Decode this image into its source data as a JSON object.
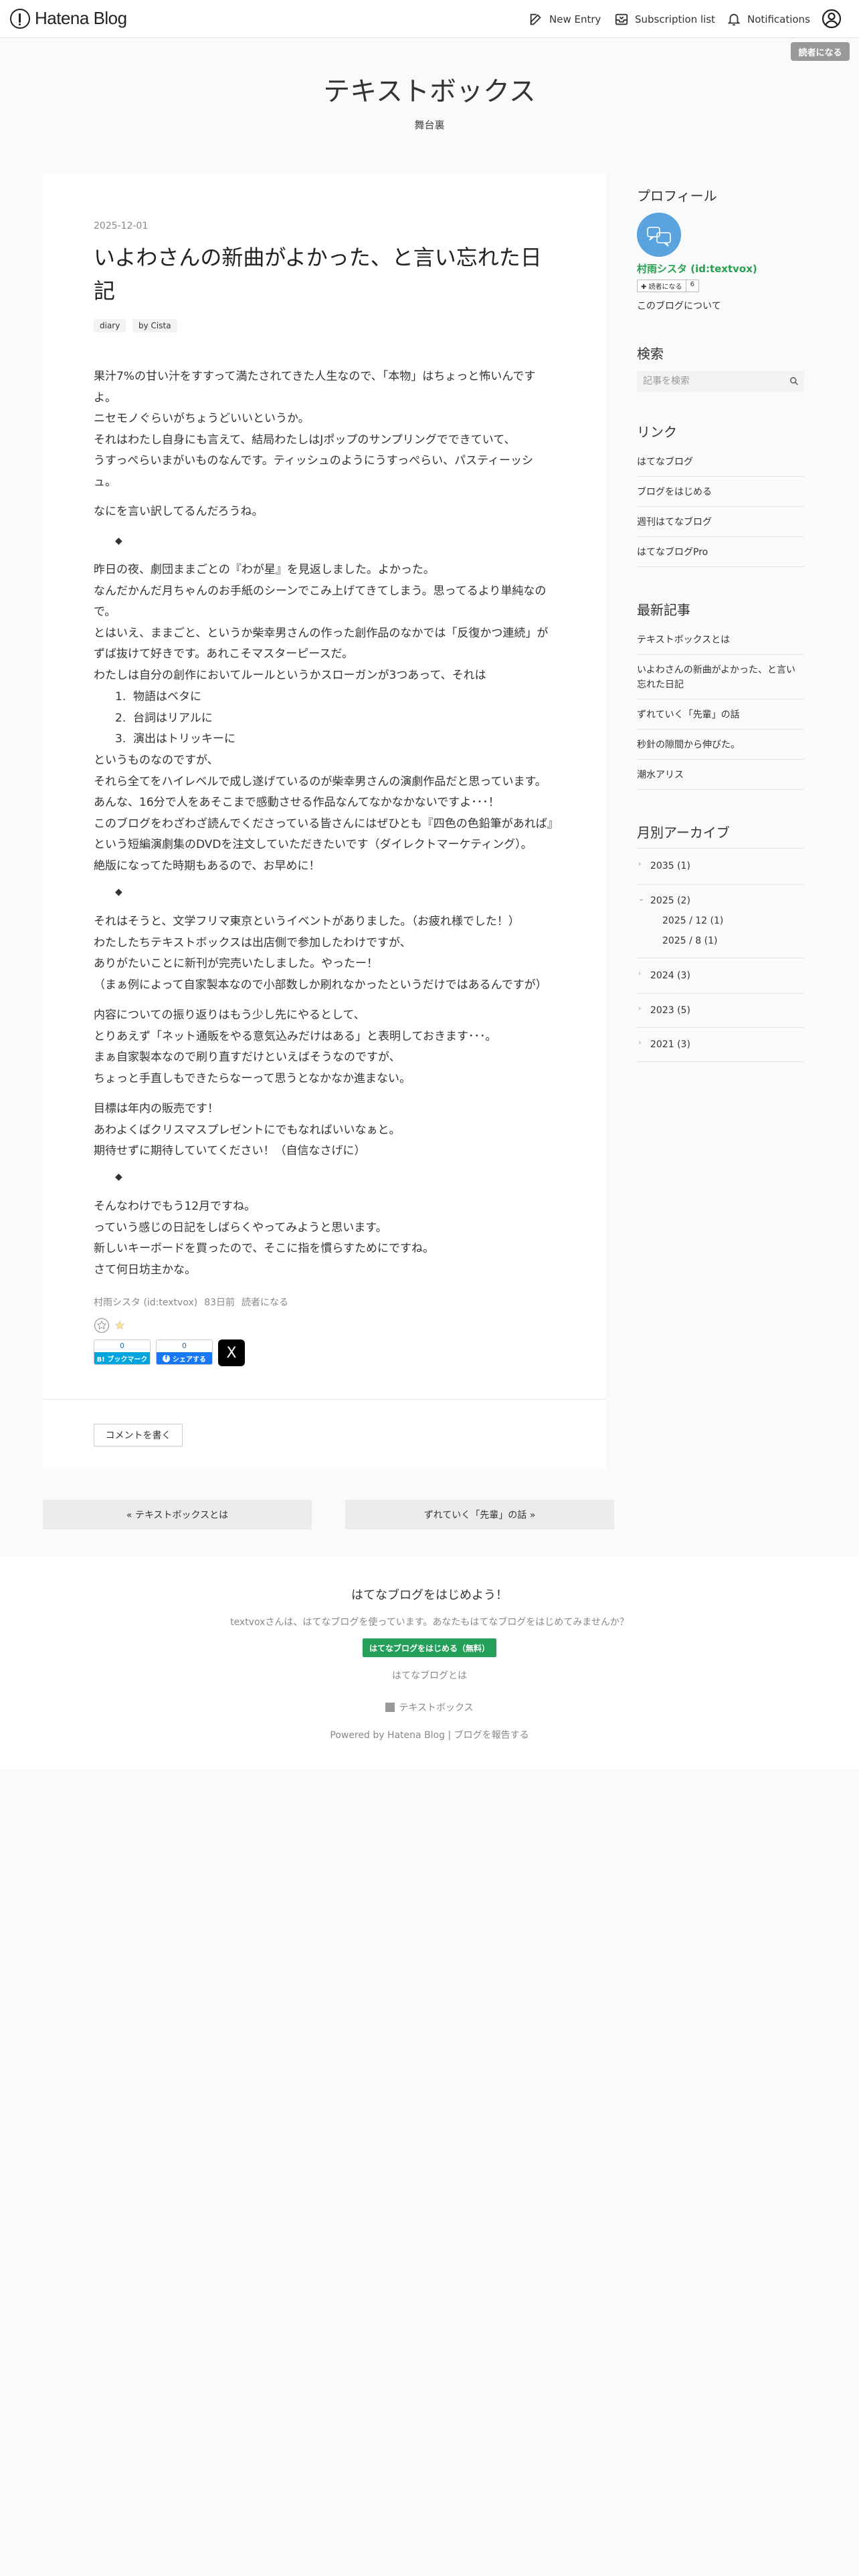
{
  "globalheader": {
    "brand": "Hatena Blog",
    "new_entry": "New Entry",
    "subscription_list": "Subscription list",
    "notifications": "Notifications"
  },
  "reader_badge": "読者になる",
  "blog": {
    "title": "テキストボックス",
    "description": "舞台裏"
  },
  "entry": {
    "date": "2025-12-01",
    "title_lines": [
      "いよわさんの新曲がよかった、と言い忘れた日",
      "記"
    ],
    "tags": [
      "diary",
      "by Cista"
    ],
    "body": {
      "p1": [
        "果汁7%の甘い汁をすすって満たされてきた人生なので、「本物」はちょっと怖いんです",
        "よ。",
        "ニセモノぐらいがちょうどいいというか。",
        "それはわたし自身にも言えて、結局わたしはJポップのサンプリングでできていて、",
        "うすっぺらいまがいものなんです。ティッシュのようにうすっぺらい、パスティーッシ",
        "ュ。"
      ],
      "p2": [
        "なにを言い訳してるんだろうね。"
      ],
      "diamond": "◆",
      "p3": [
        "昨日の夜、劇団ままごとの『わが星』を見返しました。よかった。",
        "なんだかんだ月ちゃんのお手紙のシーンでこみ上げてきてしまう。思ってるより単純なの",
        "で。",
        "とはいえ、ままごと、というか柴幸男さんの作った創作品のなかでは「反復かつ連続」が",
        "ずば抜けて好きです。あれこそマスターピースだ。",
        "わたしは自分の創作においてルールというかスローガンが3つあって、それは"
      ],
      "list": [
        "物語はベタに",
        "台詞はリアルに",
        "演出はトリッキーに"
      ],
      "p4": [
        "というものなのですが、",
        "それら全てをハイレベルで成し遂げているのが柴幸男さんの演劇作品だと思っています。",
        "あんな、16分で人をあそこまで感動させる作品なんてなかなかないですよ･･･！",
        "このブログをわざわざ読んでくださっている皆さんにはぜひとも『四色の色鉛筆があれば』",
        "という短編演劇集のDVDを注文していただきたいです（ダイレクトマーケティング）。",
        "絶版になってた時期もあるので、お早めに！"
      ],
      "p5": [
        "それはそうと、文学フリマ東京というイベントがありました。（お疲れ様でした！）",
        "わたしたちテキストボックスは出店側で参加したわけですが、",
        "ありがたいことに新刊が完売いたしました。やったー！",
        "（まぁ例によって自家製本なので小部数しか刷れなかったというだけではあるんですが）"
      ],
      "p6": [
        "内容についての振り返りはもう少し先にやるとして、",
        "とりあえず「ネット通販をやる意気込みだけはある」と表明しておきます･･･。",
        "まぁ自家製本なので刷り直すだけといえばそうなのですが、",
        "ちょっと手直しもできたらなーって思うとなかなか進まない。"
      ],
      "p7": [
        "目標は年内の販売です！",
        "あわよくばクリスマスプレゼントにでもなればいいなぁと。",
        "期待せずに期待していてください！（自信なさげに）"
      ],
      "p8": [
        "そんなわけでもう12月ですね。",
        "っていう感じの日記をしばらくやってみようと思います。",
        "新しいキーボードを買ったので、そこに指を慣らすためにですね。",
        "さて何日坊主かな。"
      ]
    },
    "footer": {
      "author": "村雨シスタ (id:textvox)",
      "ago": "83日前",
      "subscribe": "読者になる"
    },
    "share": {
      "hatebu_count": "0",
      "hatebu_label": "B! ブックマーク",
      "fb_count": "0",
      "fb_label": "シェアする",
      "x_label": "X"
    },
    "comment_button": "コメントを書く"
  },
  "pager": {
    "prev": "« テキストボックスとは",
    "next": "ずれていく「先輩」の話 »"
  },
  "sidebar": {
    "profile": {
      "heading": "プロフィール",
      "name": "村雨シスタ (id:textvox)",
      "follow_label": "読者になる",
      "follow_count": "6",
      "about": "このブログについて"
    },
    "search": {
      "heading": "検索",
      "placeholder": "記事を検索"
    },
    "links": {
      "heading": "リンク",
      "items": [
        "はてなブログ",
        "ブログをはじめる",
        "週刊はてなブログ",
        "はてなブログPro"
      ]
    },
    "recent": {
      "heading": "最新記事",
      "items": [
        "テキストボックスとは",
        "いよわさんの新曲がよかった、と言い忘れた日記",
        "ずれていく「先輩」の話",
        "秒針の隙間から伸びた。",
        "潮水アリス"
      ]
    },
    "archive": {
      "heading": "月別アーカイブ",
      "years": [
        {
          "label": "2035 (1)",
          "open": false
        },
        {
          "label": "2025 (2)",
          "open": true,
          "months": [
            "2025 / 12 (1)",
            "2025 / 8 (1)"
          ]
        },
        {
          "label": "2024 (3)",
          "open": false
        },
        {
          "label": "2023 (5)",
          "open": false
        },
        {
          "label": "2021 (3)",
          "open": false
        }
      ]
    }
  },
  "footer": {
    "cta_title": "はてなブログをはじめよう！",
    "cta_desc": "textvoxさんは、はてなブログを使っています。あなたもはてなブログをはじめてみませんか？",
    "cta_button": "はてなブログをはじめる（無料）",
    "cta_about": "はてなブログとは",
    "blog_name": "テキストボックス",
    "powered": "Powered by Hatena Blog | ブログを報告する"
  }
}
